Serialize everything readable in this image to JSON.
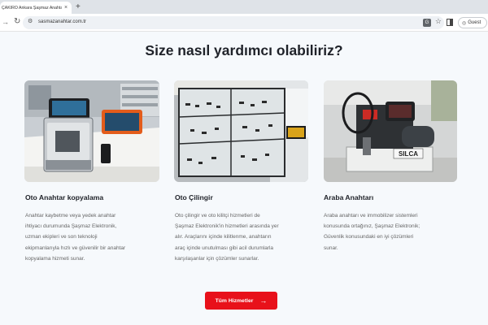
{
  "browser": {
    "tab_title": "ÇAKIRO Ankara Şaşmaz Anahtar",
    "tab_close": "×",
    "new_tab": "+",
    "url": "sasmazanahtar.com.tr",
    "guest_label": "Guest"
  },
  "page": {
    "headline": "Size nasıl yardımcı olabiliriz?",
    "cards": [
      {
        "title": "Oto Anahtar kopyalama",
        "description": "Anahtar kaybetme veya yedek anahtar\nihtiyacı durumunda Şaşmaz Elektronik,\nuzman ekipleri ve son teknoloji\nekipmanlarıyla hızlı ve güvenilir bir anahtar\nkopyalama hizmeti sunar."
      },
      {
        "title": "Oto Çilingir",
        "description": "Oto çilingir ve oto kilitçi hizmetleri de\nŞaşmaz Elektronik'in hizmetleri arasında yer\nalır. Araçlarını içinde kilitlenme, anahtarın\naraç içinde unutulması gibi acil durumlarla\nkarşılaşanlar için çözümler sunarlar."
      },
      {
        "title": "Araba Anahtarı",
        "description": "Araba anahtarı ve immobilizer sistemleri\nkonusunda ortağınız, Şaşmaz Elektronik;\nGüvenlik konusundaki en iyi çözümleri\nsunar."
      }
    ],
    "cta_label": "Tüm Hizmetler",
    "cta_arrow": "→",
    "machine_brand": "SILCA"
  },
  "colors": {
    "accent": "#e8111a",
    "page_background": "#f6f9fc"
  }
}
